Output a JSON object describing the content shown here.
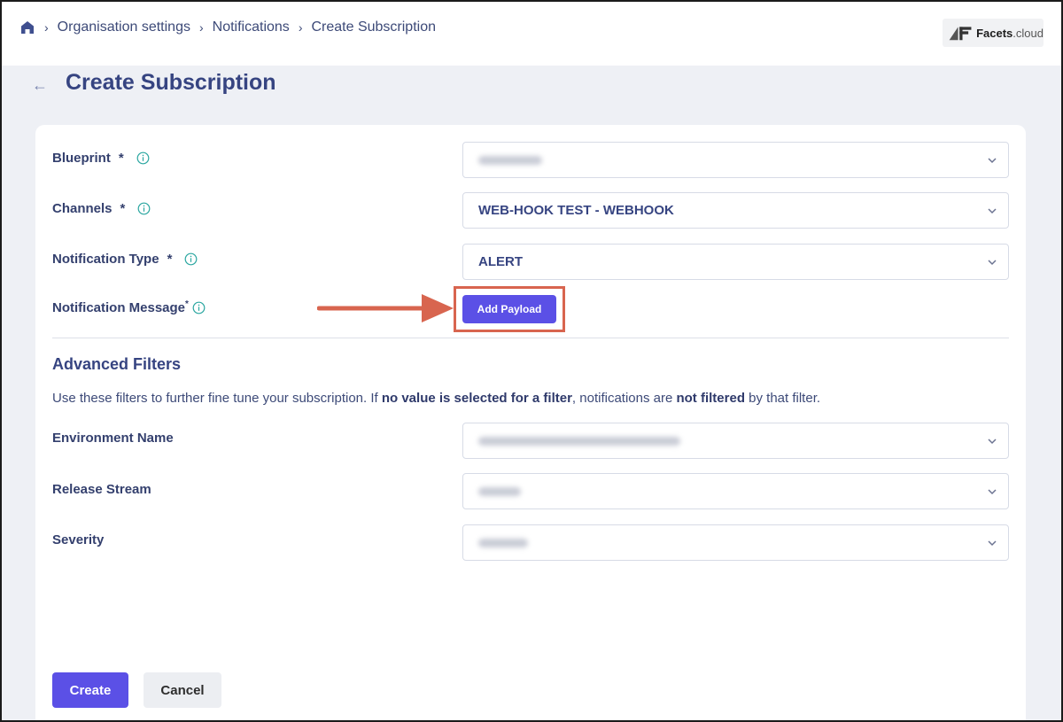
{
  "breadcrumb": {
    "home_icon": "home-icon",
    "items": [
      "Organisation settings",
      "Notifications",
      "Create Subscription"
    ]
  },
  "logo": {
    "text_bold": "Facets",
    "text_light": ".cloud"
  },
  "page": {
    "title": "Create Subscription",
    "back_icon": "arrow-left-icon"
  },
  "form": {
    "blueprint": {
      "label": "Blueprint",
      "required": "*",
      "value": "",
      "value_blurred": true
    },
    "channels": {
      "label": "Channels",
      "required": "*",
      "value": "WEB-HOOK TEST - WEBHOOK"
    },
    "notification_type": {
      "label": "Notification Type",
      "required": "*",
      "value": "ALERT"
    },
    "notification_message": {
      "label": "Notification Message",
      "required": "*",
      "button": "Add Payload"
    }
  },
  "advanced": {
    "title": "Advanced Filters",
    "hint_parts": [
      "Use these filters to further fine tune your subscription. If ",
      "no value is selected for a filter",
      ", notifications are ",
      "not filtered",
      " by that filter."
    ],
    "environment_name": {
      "label": "Environment Name",
      "value": "",
      "value_blurred": true
    },
    "release_stream": {
      "label": "Release Stream",
      "value": "",
      "value_blurred": true
    },
    "severity": {
      "label": "Severity",
      "value": "",
      "value_blurred": true
    }
  },
  "actions": {
    "create": "Create",
    "cancel": "Cancel"
  },
  "colors": {
    "primary": "#5b50e6",
    "title": "#364481",
    "annotation": "#d8654f",
    "info_icon": "#2aa6a0"
  }
}
